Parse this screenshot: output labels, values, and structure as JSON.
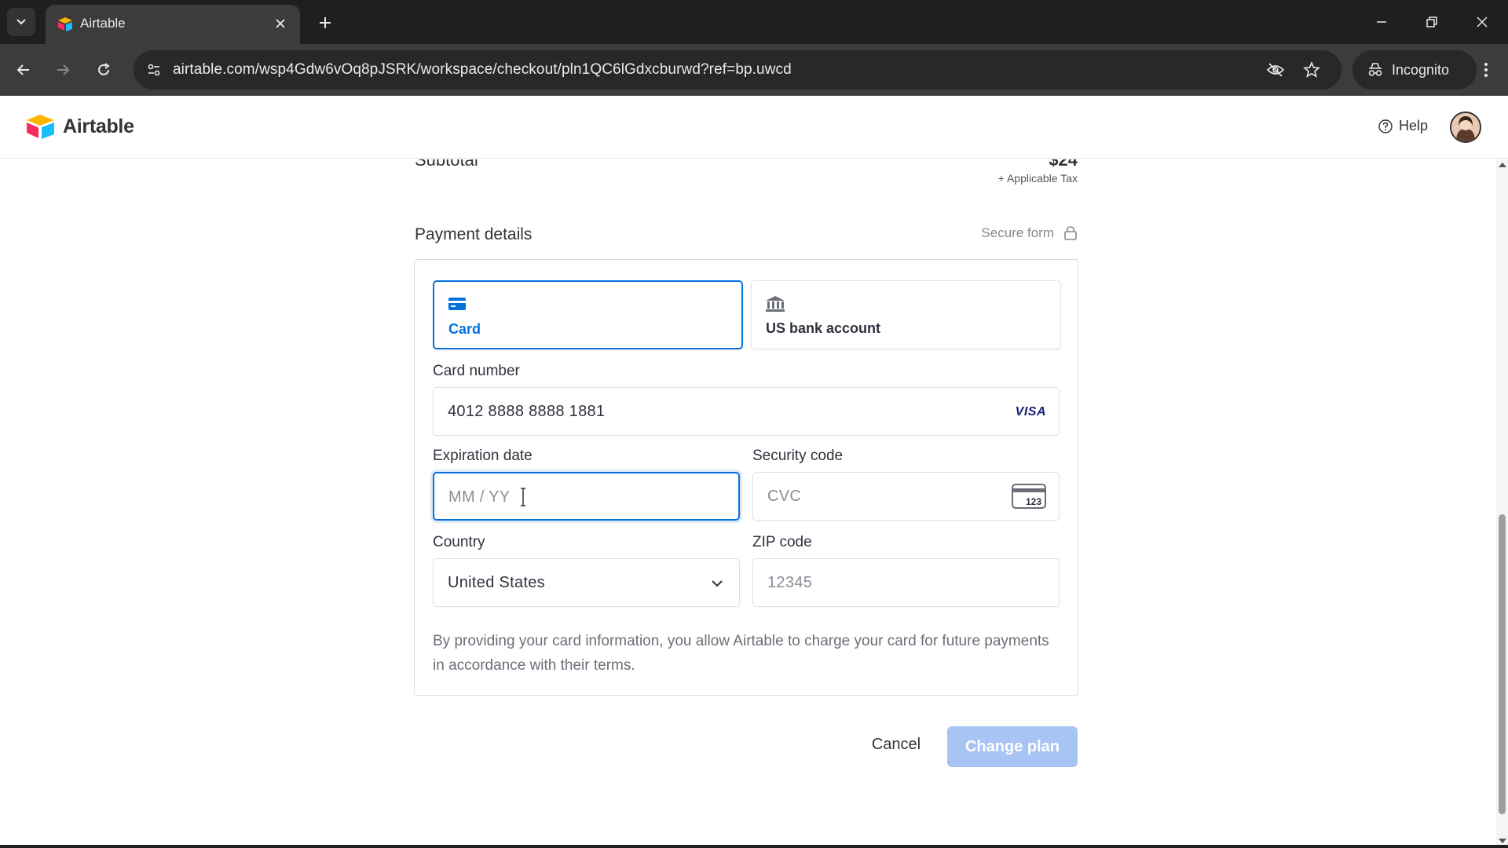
{
  "browser": {
    "tab_title": "Airtable",
    "url": "airtable.com/wsp4Gdw6vOq8pJSRK/workspace/checkout/pln1QC6lGdxcburwd?ref=bp.uwcd",
    "incognito_label": "Incognito"
  },
  "header": {
    "logo_text": "Airtable",
    "help_label": "Help"
  },
  "summary": {
    "subtotal_label": "Subtotal",
    "subtotal_value": "$24",
    "tax_note": "+ Applicable Tax"
  },
  "payment": {
    "title": "Payment details",
    "secure_label": "Secure form",
    "methods": [
      {
        "label": "Card",
        "icon": "credit-card-icon",
        "selected": true
      },
      {
        "label": "US bank account",
        "icon": "bank-icon",
        "selected": false
      }
    ],
    "card_number": {
      "label": "Card number",
      "value": "4012 8888 8888 1881",
      "brand": "VISA"
    },
    "expiration": {
      "label": "Expiration date",
      "placeholder": "MM / YY",
      "value": ""
    },
    "security_code": {
      "label": "Security code",
      "placeholder": "CVC",
      "icon_text": "123"
    },
    "country": {
      "label": "Country",
      "value": "United States"
    },
    "zip": {
      "label": "ZIP code",
      "placeholder": "12345"
    },
    "consent": "By providing your card information, you allow Airtable to charge your card for future payments in accordance with their terms."
  },
  "actions": {
    "cancel_label": "Cancel",
    "submit_label": "Change plan"
  },
  "colors": {
    "accent": "#0570de",
    "submit_disabled": "#a7c4f5"
  }
}
